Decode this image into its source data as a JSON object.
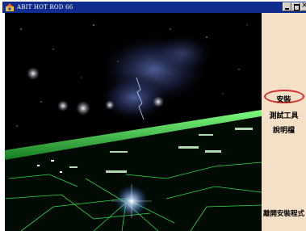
{
  "window": {
    "title": "ABIT HOT ROD 66",
    "controls": {
      "minimize": "minimize",
      "maximize": "maximize",
      "close": "close"
    }
  },
  "menu": {
    "install": "安裝",
    "tools": "測試工具",
    "readme": "說明檔",
    "exit": "離開安裝程式"
  },
  "colors": {
    "titlebar": "#102c8e",
    "side_panel": "#f3e0c7",
    "highlight": "#d43030",
    "circuit_green": "#33ff55"
  },
  "icons": [
    "app-icon",
    "minimize-icon",
    "maximize-icon",
    "close-icon"
  ]
}
